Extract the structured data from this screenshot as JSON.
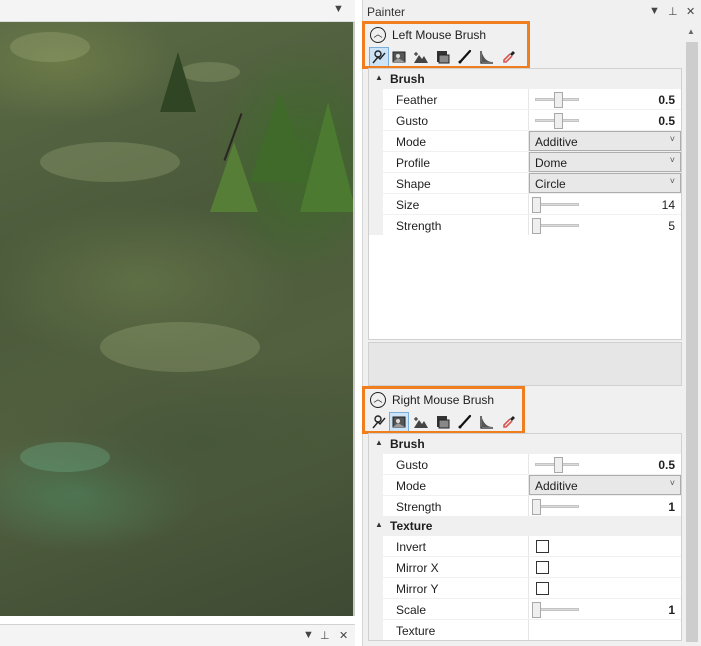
{
  "viewport": {
    "header_icons": [
      "chevron-down-icon"
    ],
    "bottom_panel_icons": [
      "chevron-down-icon",
      "pin-icon",
      "close-icon"
    ]
  },
  "painter": {
    "title": "Painter",
    "header_icons": [
      "chevron-down-icon",
      "pin-icon",
      "close-icon"
    ],
    "left_brush": {
      "title": "Left Mouse Brush",
      "active_tool": "sculpt",
      "brush_category": "Brush",
      "properties": [
        {
          "name": "Feather",
          "kind": "slider",
          "value": "0.5",
          "level": 0.5,
          "bold": true
        },
        {
          "name": "Gusto",
          "kind": "slider",
          "value": "0.5",
          "level": 0.5,
          "bold": true
        },
        {
          "name": "Mode",
          "kind": "select",
          "value": "Additive"
        },
        {
          "name": "Profile",
          "kind": "select",
          "value": "Dome"
        },
        {
          "name": "Shape",
          "kind": "select",
          "value": "Circle"
        },
        {
          "name": "Size",
          "kind": "slider",
          "value": "14",
          "level": 0.0,
          "bold": false
        },
        {
          "name": "Strength",
          "kind": "slider",
          "value": "5",
          "level": 0.0,
          "bold": false
        }
      ]
    },
    "right_brush": {
      "title": "Right Mouse Brush",
      "active_tool": "texture-paint",
      "brush_category": "Brush",
      "brush_properties": [
        {
          "name": "Gusto",
          "kind": "slider",
          "value": "0.5",
          "level": 0.5,
          "bold": true
        },
        {
          "name": "Mode",
          "kind": "select",
          "value": "Additive"
        },
        {
          "name": "Strength",
          "kind": "slider",
          "value": "1",
          "level": 0.0,
          "bold": true
        }
      ],
      "texture_category": "Texture",
      "texture_properties": [
        {
          "name": "Invert",
          "kind": "checkbox",
          "checked": false
        },
        {
          "name": "Mirror X",
          "kind": "checkbox",
          "checked": false
        },
        {
          "name": "Mirror Y",
          "kind": "checkbox",
          "checked": false
        },
        {
          "name": "Scale",
          "kind": "slider",
          "value": "1",
          "level": 0.0,
          "bold": true
        },
        {
          "name": "Texture",
          "kind": "text",
          "value": ""
        }
      ]
    },
    "tools": [
      "sculpt-icon",
      "texture-paint-icon",
      "terrain-icon",
      "stamp-icon",
      "brush-icon",
      "profile-curve-icon",
      "eyedropper-icon"
    ],
    "highlight_color": "#f07d1e"
  }
}
